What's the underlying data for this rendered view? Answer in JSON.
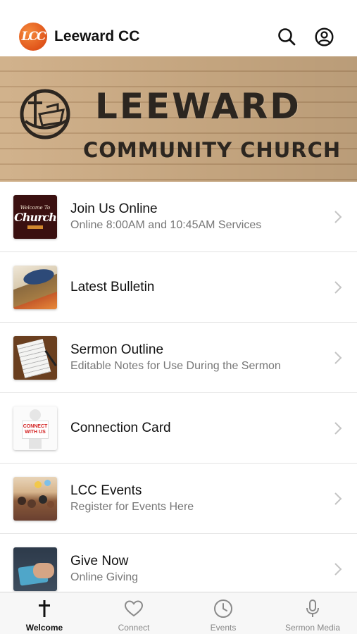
{
  "header": {
    "app_title": "Leeward CC",
    "logo_text": "LCC",
    "icons": [
      "search-icon",
      "account-icon"
    ]
  },
  "hero": {
    "line1": "LEEWARD",
    "line2": "COMMUNITY CHURCH"
  },
  "list": {
    "items": [
      {
        "title": "Join Us Online",
        "subtitle": "Online 8:00AM and 10:45AM Services",
        "thumb_text": [
          "Welcome To",
          "Church"
        ]
      },
      {
        "title": "Latest Bulletin",
        "subtitle": ""
      },
      {
        "title": "Sermon Outline",
        "subtitle": "Editable Notes for Use During the Sermon"
      },
      {
        "title": "Connection Card",
        "subtitle": "",
        "thumb_text": [
          "CONNECT",
          "WITH US"
        ]
      },
      {
        "title": "LCC Events",
        "subtitle": "Register for Events Here"
      },
      {
        "title": "Give Now",
        "subtitle": "Online Giving"
      }
    ]
  },
  "tabbar": {
    "tabs": [
      {
        "label": "Welcome",
        "icon": "cross-icon",
        "active": true
      },
      {
        "label": "Connect",
        "icon": "heart-icon",
        "active": false
      },
      {
        "label": "Events",
        "icon": "clock-icon",
        "active": false
      },
      {
        "label": "Sermon Media",
        "icon": "microphone-icon",
        "active": false
      }
    ]
  },
  "colors": {
    "brand_orange": "#e0541a",
    "hero_wood": "#cfae86",
    "lettering": "#2c2620",
    "subtitle_gray": "#777777"
  }
}
